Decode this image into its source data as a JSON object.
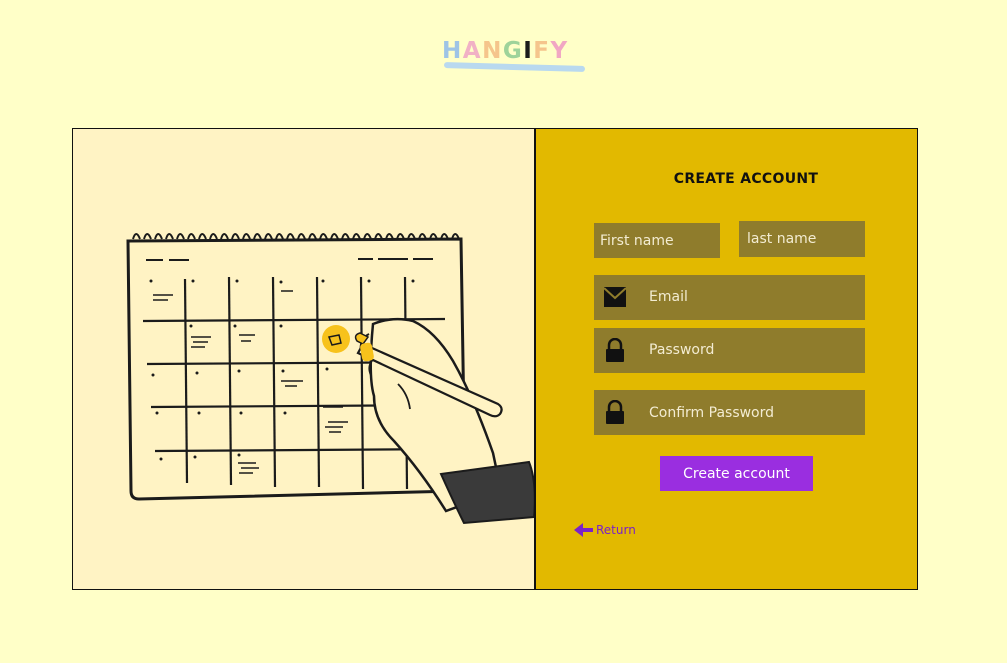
{
  "brand": {
    "letters": [
      "H",
      "A",
      "N",
      "G",
      "I",
      "F",
      "Y"
    ],
    "letter_colors": [
      "#9ec4e6",
      "#f1b1c5",
      "#f5c58c",
      "#9ed39a",
      "#1b1b1b",
      "#f5c58c",
      "#f1a7c3"
    ]
  },
  "form": {
    "title": "CREATE ACCOUNT",
    "first_name_placeholder": "First name",
    "last_name_placeholder": "last name",
    "email_placeholder": "Email",
    "password_placeholder": "Password",
    "confirm_password_placeholder": "Confirm Password",
    "submit_label": "Create account",
    "return_label": "Return"
  },
  "colors": {
    "page_bg": "#ffffc8",
    "panel_bg": "#e2b900",
    "field_bg": "#8f7c2c",
    "button_bg": "#9a2ee0",
    "link": "#7b22c8",
    "illustration_bg": "#fff3c4"
  },
  "icons": {
    "email": "envelope-icon",
    "password": "lock-icon",
    "confirm_password": "lock-icon",
    "return": "arrow-left-icon"
  }
}
